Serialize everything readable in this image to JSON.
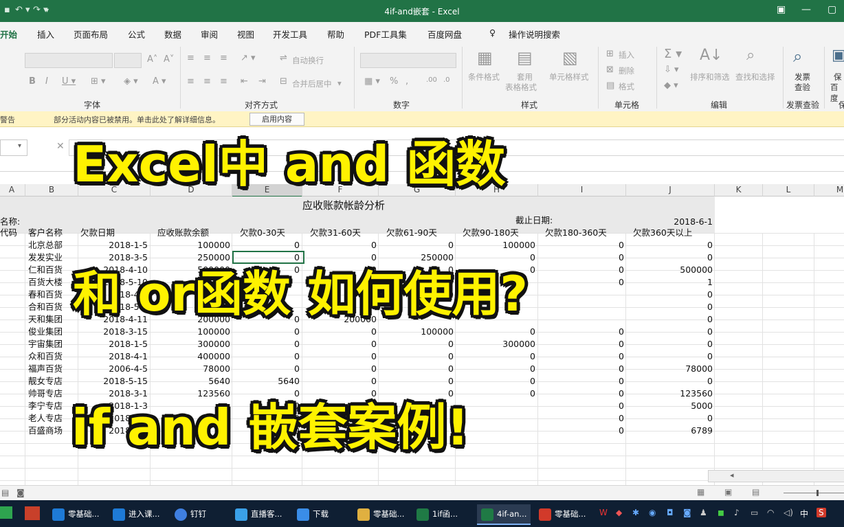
{
  "window": {
    "title": "4if-and嵌套  -  Excel",
    "accent": "#217346"
  },
  "menu": {
    "tabs": [
      "开始",
      "插入",
      "页面布局",
      "公式",
      "数据",
      "审阅",
      "视图",
      "开发工具",
      "帮助",
      "PDF工具集",
      "百度网盘"
    ],
    "active_tab": "开始",
    "tell_me": "操作说明搜索"
  },
  "ribbon": {
    "groups": {
      "font": "字体",
      "alignment": "对齐方式",
      "number": "数字",
      "styles": "样式",
      "cells": "单元格",
      "editing": "编辑",
      "invoice": "发票查验",
      "protect": "保"
    },
    "commands": {
      "wrap_text": "自动换行",
      "merge_center": "合并后居中",
      "conditional_format": "条件格式",
      "format_as_table_1": "套用",
      "format_as_table_2": "表格格式",
      "cell_styles": "单元格样式",
      "insert": "插入",
      "delete": "删除",
      "format": "格式",
      "sort_filter": "排序和筛选",
      "find_select": "查找和选择",
      "invoice_check_1": "发票",
      "invoice_check_2": "查验",
      "protect_1": "保",
      "protect_2": "百度"
    }
  },
  "security_bar": {
    "title": "警告",
    "message": "部分活动内容已被禁用。单击此处了解详细信息。",
    "button": "启用内容"
  },
  "sheet": {
    "columns": [
      "A",
      "B",
      "C",
      "D",
      "E",
      "F",
      "G",
      "H",
      "I",
      "J",
      "K",
      "L",
      "M"
    ],
    "title": "应收账款帐龄分析",
    "name_label": "名称:",
    "cutoff_label": "截止日期:",
    "cutoff_date": "2018-6-1",
    "headers": [
      "代码",
      "客户名称",
      "欠款日期",
      "应收账款余额",
      "欠款0-30天",
      "欠款31-60天",
      "欠款61-90天",
      "欠款90-180天",
      "欠款180-360天",
      "欠款360天以上"
    ],
    "rows": [
      [
        "北京总部",
        "2018-1-5",
        "100000",
        "0",
        "0",
        "0",
        "100000",
        "0",
        "0"
      ],
      [
        "发发实业",
        "2018-3-5",
        "250000",
        "0",
        "0",
        "250000",
        "0",
        "0",
        "0"
      ],
      [
        "仁和百货",
        "2018-4-10",
        "500000",
        "0",
        "0",
        "0",
        "0",
        "0",
        "500000"
      ],
      [
        "百货大楼",
        "2018-5-10",
        "",
        "",
        "0",
        "",
        "",
        "0",
        "1"
      ],
      [
        "春和百货",
        "2018-4-3",
        "",
        "",
        "",
        "0",
        "",
        "",
        "0"
      ],
      [
        "合和百货",
        "2018-5-5",
        "",
        "",
        "",
        "",
        "",
        "",
        "0"
      ],
      [
        "天和集团",
        "2018-4-11",
        "200000",
        "0",
        "200000",
        "",
        "",
        "",
        "0"
      ],
      [
        "俊业集团",
        "2018-3-15",
        "100000",
        "0",
        "0",
        "100000",
        "0",
        "0",
        "0"
      ],
      [
        "宇宙集团",
        "2018-1-5",
        "300000",
        "0",
        "0",
        "0",
        "300000",
        "0",
        "0"
      ],
      [
        "众和百货",
        "2018-4-1",
        "400000",
        "0",
        "0",
        "0",
        "0",
        "0",
        "0"
      ],
      [
        "福声百货",
        "2006-4-5",
        "78000",
        "0",
        "0",
        "0",
        "0",
        "0",
        "78000"
      ],
      [
        "靓女专店",
        "2018-5-15",
        "5640",
        "5640",
        "0",
        "0",
        "0",
        "0",
        "0"
      ],
      [
        "帅哥专店",
        "2018-3-1",
        "123560",
        "0",
        "0",
        "0",
        "0",
        "0",
        "123560"
      ],
      [
        "李宁专店",
        "2018-1-3",
        "",
        "0",
        "",
        "",
        "",
        "0",
        "5000"
      ],
      [
        "老人专店",
        "2018-2-3",
        "",
        "0",
        "",
        "",
        "",
        "0",
        "0"
      ],
      [
        "百盛商场",
        "2018-1-3",
        "",
        "0",
        "",
        "",
        "",
        "0",
        "6789"
      ]
    ]
  },
  "overlay": {
    "line1": "Excel中 and 函数",
    "line2": "和 or函数 如何使用?",
    "line3": "if and 嵌套案例!"
  },
  "taskbar": {
    "items": [
      "零基础...",
      "进入课...",
      "钉钉",
      "直播客...",
      "下载",
      "零基础...",
      "1if函...",
      "4if-an...",
      "零基础..."
    ],
    "active_item": "4if-an...",
    "ime": "中"
  }
}
